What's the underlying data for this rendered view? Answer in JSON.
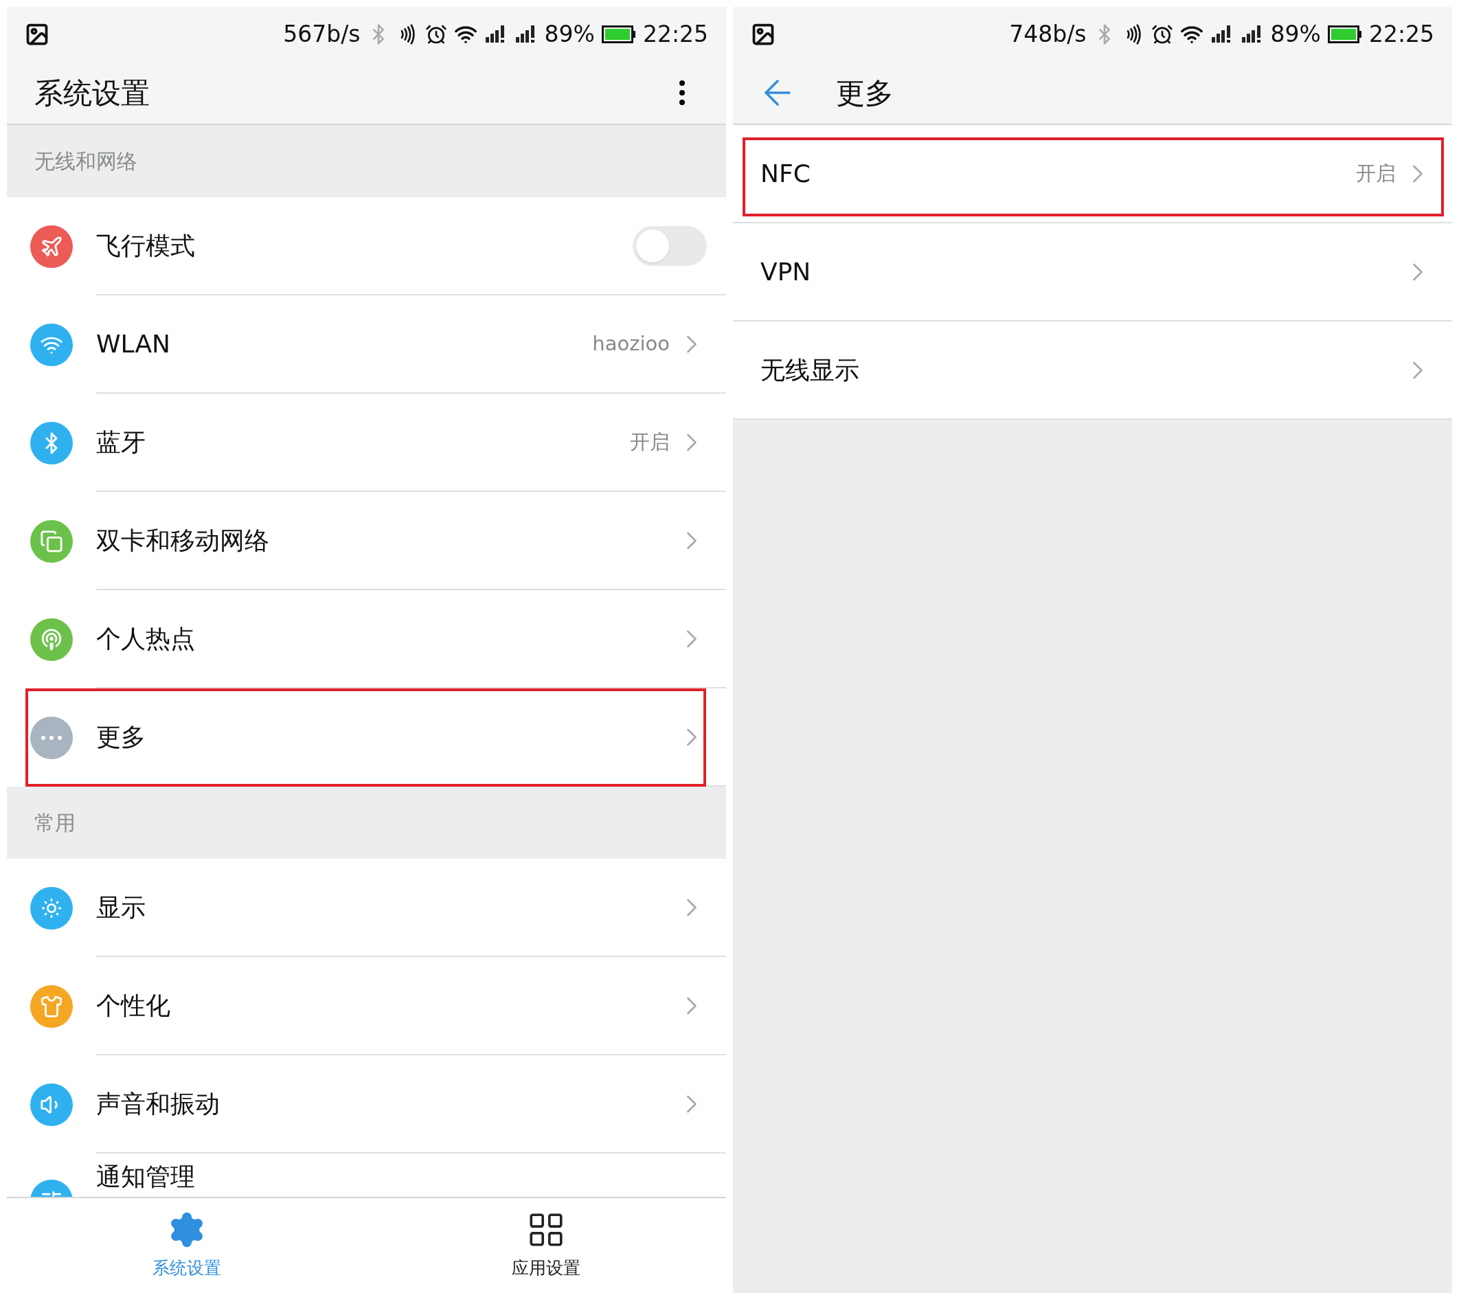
{
  "screens": [
    {
      "status_bar": {
        "speed": "567b/s",
        "battery": "89%",
        "time": "22:25"
      },
      "header": {
        "kind": "menu",
        "title": "系统设置"
      },
      "sections": [
        {
          "title": "无线和网络",
          "items": [
            {
              "kind": "toggle",
              "label": "飞行模式",
              "color": "#ec5b55",
              "on": false,
              "highlighted": false
            },
            {
              "kind": "link",
              "label": "WLAN",
              "value": "haozioo",
              "color": "#2fb1ef",
              "highlighted": false
            },
            {
              "kind": "link",
              "label": "蓝牙",
              "value": "开启",
              "color": "#2fb1ef",
              "highlighted": false
            },
            {
              "kind": "link",
              "label": "双卡和移动网络",
              "color": "#6cc14a",
              "highlighted": false
            },
            {
              "kind": "link",
              "label": "个人热点",
              "color": "#6cc14a",
              "highlighted": false
            },
            {
              "kind": "link",
              "label": "更多",
              "color": "#a8b4bf",
              "highlighted": true
            }
          ]
        },
        {
          "title": "常用",
          "items": [
            {
              "kind": "link",
              "label": "显示",
              "color": "#2fb1ef",
              "highlighted": false
            },
            {
              "kind": "link",
              "label": "个性化",
              "color": "#f5a623",
              "highlighted": false
            },
            {
              "kind": "link",
              "label": "声音和振动",
              "color": "#2fb1ef",
              "highlighted": false
            },
            {
              "kind": "partial",
              "label": "通知管理",
              "color": "#2fb1ef",
              "highlighted": false
            }
          ]
        }
      ],
      "bottom_nav": [
        {
          "label": "系统设置",
          "selected": true
        },
        {
          "label": "应用设置",
          "selected": false
        }
      ]
    },
    {
      "status_bar": {
        "speed": "748b/s",
        "battery": "89%",
        "time": "22:25"
      },
      "header": {
        "kind": "back",
        "title": "更多"
      },
      "sections": [
        {
          "items": [
            {
              "kind": "link",
              "label": "NFC",
              "value": "开启",
              "highlighted": true
            },
            {
              "kind": "link",
              "label": "VPN",
              "highlighted": false
            },
            {
              "kind": "link",
              "label": "无线显示",
              "highlighted": false
            }
          ]
        }
      ]
    }
  ]
}
